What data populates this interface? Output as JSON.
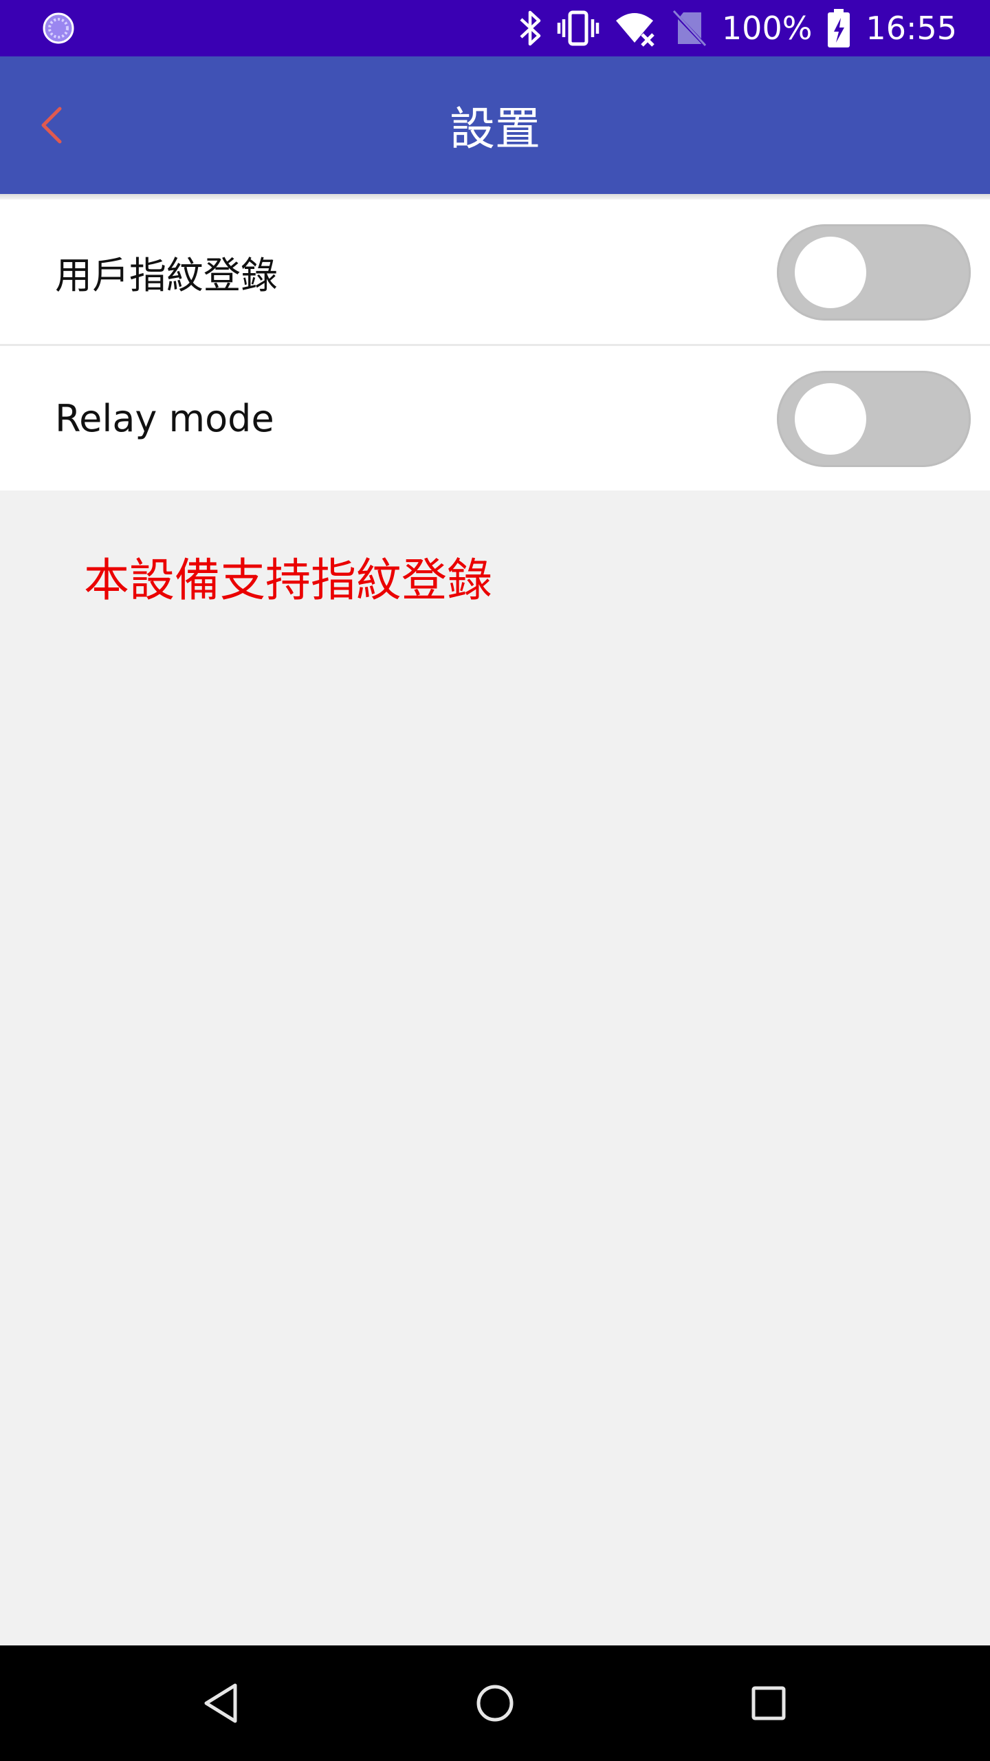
{
  "status_bar": {
    "battery_percent": "100%",
    "time": "16:55",
    "icons": [
      "app-notification-icon",
      "bluetooth-icon",
      "vibrate-icon",
      "wifi-no-internet-icon",
      "no-sim-icon",
      "battery-charging-icon"
    ]
  },
  "app_bar": {
    "title": "設置",
    "back_icon": "chevron-left-icon",
    "back_color": "#e05a4f"
  },
  "settings": {
    "items": [
      {
        "label": "用戶指紋登錄",
        "enabled": false
      },
      {
        "label": "Relay mode",
        "enabled": false
      }
    ]
  },
  "note": {
    "text": "本設備支持指紋登錄",
    "color": "#ea0000"
  },
  "nav_bar": {
    "buttons": [
      "back-triangle-icon",
      "home-circle-icon",
      "recents-square-icon"
    ]
  },
  "colors": {
    "status_bar": "#3a00b3",
    "app_bar": "#4052b5",
    "background": "#f1f1f1",
    "toggle_off": "#c4c4c4"
  }
}
